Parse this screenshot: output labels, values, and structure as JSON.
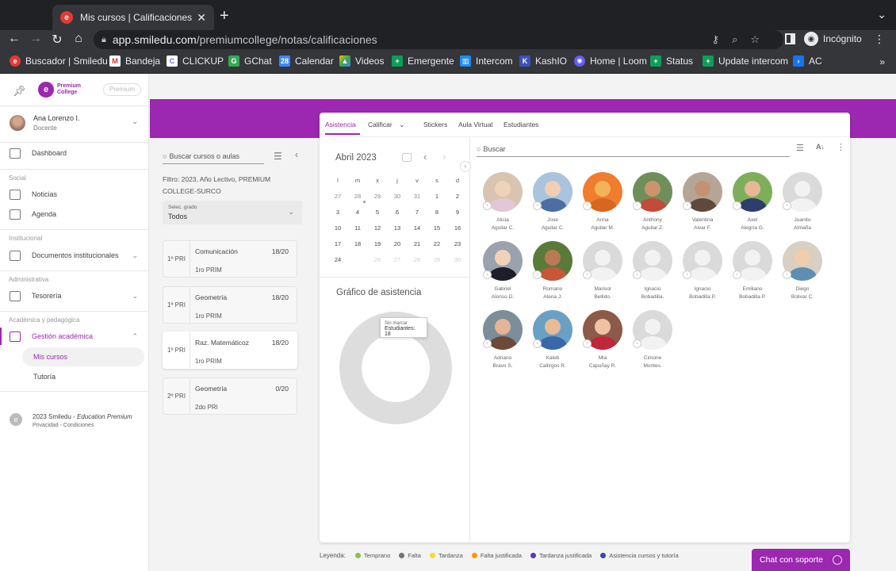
{
  "browser": {
    "tab_title": "Mis cursos | Calificaciones",
    "url_host": "app.smiledu.com",
    "url_path": "/premiumcollege/notas/calificaciones",
    "incognito_label": "Incógnito",
    "bookmarks": [
      "Buscador | Smiledu",
      "Bandeja",
      "CLICKUP",
      "GChat",
      "Calendar",
      "Videos",
      "Emergente",
      "Intercom",
      "KashIO",
      "Home | Loom",
      "Status",
      "Update intercom",
      "AC"
    ],
    "bookmark_more": "»"
  },
  "sidebar": {
    "logo_text": "Premium College",
    "badge": "Premium",
    "user": {
      "name": "Ana Lorenzo I.",
      "role": "Docente"
    },
    "items": [
      {
        "label": "Dashboard"
      },
      {
        "section": "Social"
      },
      {
        "label": "Noticias"
      },
      {
        "label": "Agenda"
      },
      {
        "section": "Institucional"
      },
      {
        "label": "Documentos institucionales"
      },
      {
        "section": "Administrativa"
      },
      {
        "label": "Tesorería"
      },
      {
        "section": "Académica y pedagógica"
      },
      {
        "label": "Gestión académica"
      }
    ],
    "subitems": [
      "Mis cursos",
      "Tutoría"
    ],
    "footer": {
      "copyright": "2023 Smiledu - ",
      "edition": "Education Premium",
      "links": "Privacidad - Condiciones"
    }
  },
  "courses_panel": {
    "search_placeholder": "Buscar cursos o aulas",
    "filter_text": "Filtro: 2023, Año Lectivo, PREMIUM COLLEGE-SURCO",
    "grade_select": {
      "label": "Selec. grado",
      "value": "Todos"
    },
    "courses": [
      {
        "grade": "1º PRI",
        "name": "Comunicación",
        "score": "18/20",
        "section": "1ro PRIM"
      },
      {
        "grade": "1º PRI",
        "name": "Geometría",
        "score": "18/20",
        "section": "1ro PRIM"
      },
      {
        "grade": "1º PRI",
        "name": "Raz. Matemáticoz",
        "score": "18/20",
        "section": "1ro PRIM"
      },
      {
        "grade": "2º PRI",
        "name": "Geometría",
        "score": "0/20",
        "section": "2do PRI"
      }
    ]
  },
  "card": {
    "tabs": [
      "Asistencia",
      "Calificar",
      "Stickers",
      "Aula Virtual",
      "Estudiantes"
    ],
    "calendar": {
      "month": "Abril 2023",
      "weekdays": [
        "l",
        "m",
        "x",
        "j",
        "v",
        "s",
        "d"
      ],
      "weeks": [
        [
          "27",
          "28",
          "29",
          "30",
          "31",
          "1",
          "2"
        ],
        [
          "3",
          "4",
          "5",
          "6",
          "7",
          "8",
          "9"
        ],
        [
          "10",
          "11",
          "12",
          "13",
          "14",
          "15",
          "16"
        ],
        [
          "17",
          "18",
          "19",
          "20",
          "21",
          "22",
          "23"
        ],
        [
          "24",
          "25",
          "26",
          "27",
          "28",
          "29",
          "30"
        ]
      ],
      "today": "25"
    },
    "attendance": {
      "title": "Gráfico de asistencia",
      "tooltip_label": "Sin marcar",
      "tooltip_value": "Estudiantes: 18"
    },
    "student_search_placeholder": "Buscar",
    "students": [
      {
        "first": "Alicia",
        "last": "Aguilar C."
      },
      {
        "first": "Jose",
        "last": "Aguilar C."
      },
      {
        "first": "Anna",
        "last": "Aguilar M."
      },
      {
        "first": "Anthony",
        "last": "Aguilar Z."
      },
      {
        "first": "Valentina",
        "last": "Aivar F."
      },
      {
        "first": "Axel",
        "last": "Alegría G."
      },
      {
        "first": "Juanito",
        "last": "Almaña"
      },
      {
        "first": "Gabriel",
        "last": "Alonso D."
      },
      {
        "first": "Romario",
        "last": "Atena J."
      },
      {
        "first": "Marisol",
        "last": "Bellido."
      },
      {
        "first": "Ignacio",
        "last": "Bobadilla."
      },
      {
        "first": "Ignacio",
        "last": "Bobadilla P."
      },
      {
        "first": "Emiliano",
        "last": "Bobadilla P."
      },
      {
        "first": "Diego",
        "last": "Bolivar C."
      },
      {
        "first": "Adriano",
        "last": "Bravo S."
      },
      {
        "first": "Kaleb",
        "last": "Callirgos R."
      },
      {
        "first": "Mia",
        "last": "Capuñay R."
      },
      {
        "first": "Cimone",
        "last": "Montes."
      }
    ],
    "badge_symbol": "-"
  },
  "legend": {
    "title": "Leyenda:",
    "items": [
      {
        "label": "Temprano",
        "color": "#8bc34a"
      },
      {
        "label": "Falta",
        "color": "#757575"
      },
      {
        "label": "Tardanza",
        "color": "#fdd835"
      },
      {
        "label": "Falta justificada",
        "color": "#ff9800"
      },
      {
        "label": "Tardanza justificada",
        "color": "#5e35b1"
      },
      {
        "label": "Asistencia cursos y tutoría",
        "color": "#3949ab"
      }
    ]
  },
  "chat": {
    "label": "Chat con soporte"
  },
  "colors": {
    "brand": "#9c27b0",
    "today": "#fbc02d"
  }
}
